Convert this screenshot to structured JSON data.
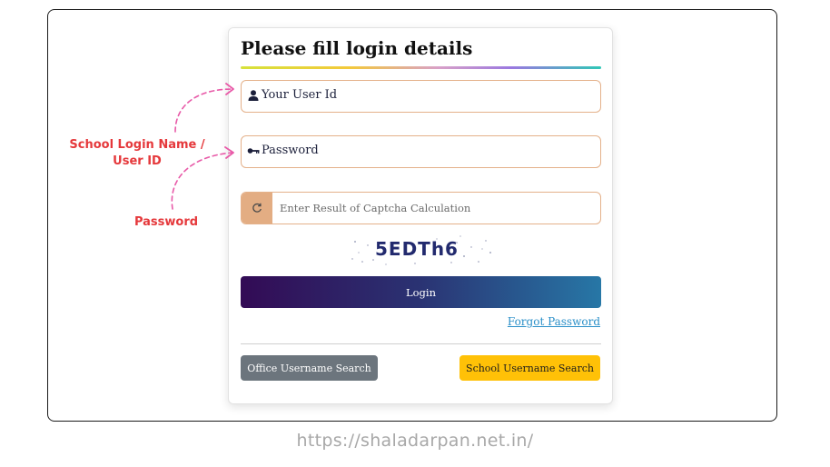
{
  "login_form": {
    "title": "Please fill login details",
    "user_id_label": "Your User Id",
    "password_label": "Password",
    "captcha_placeholder": "Enter Result of Captcha Calculation",
    "captcha_text": "5EDTh6",
    "login_button": "Login",
    "forgot_password": "Forgot Password",
    "office_search_button": "Office Username Search",
    "school_search_button": "School Username Search"
  },
  "annotations": {
    "user_id_note": "School Login Name / User ID",
    "user_id_note_line1": "School Login Name /",
    "user_id_note_line2": "User ID",
    "password_note": "Password"
  },
  "footer_url": "https://shaladarpan.net.in/",
  "icons": [
    "user-icon",
    "key-icon",
    "refresh-icon"
  ],
  "colors": {
    "annotation_red": "#e5383b",
    "arrow_pink": "#e85aa8",
    "field_border": "#e4b18a",
    "captcha_button_bg": "#e3ad83",
    "login_gradient_start": "#330b55",
    "login_gradient_end": "#2777a6",
    "office_button": "#6c757d",
    "school_button": "#ffc107",
    "forgot_link": "#2a8fc8"
  }
}
